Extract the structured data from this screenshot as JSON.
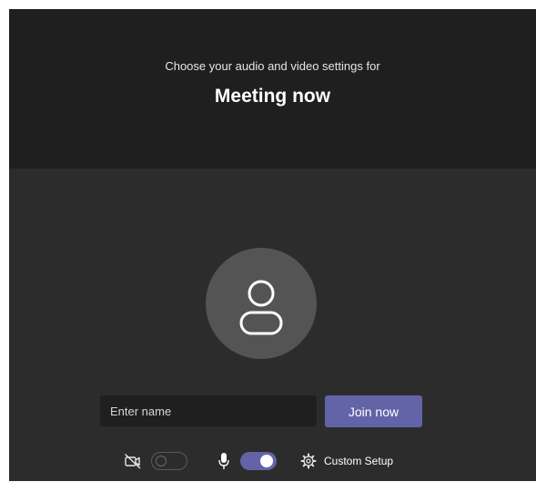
{
  "header": {
    "subtitle": "Choose your audio and video settings for",
    "meeting_title": "Meeting now"
  },
  "prejoin": {
    "avatar_icon": "person-icon",
    "name_input": {
      "value": "",
      "placeholder": "Enter name"
    },
    "join_label": "Join now"
  },
  "controls": {
    "camera": {
      "icon": "camera-off-icon",
      "enabled": false
    },
    "microphone": {
      "icon": "microphone-icon",
      "enabled": true
    },
    "custom_setup": {
      "icon": "gear-icon",
      "label": "Custom Setup"
    }
  },
  "colors": {
    "accent": "#6264a7",
    "header_bg": "#1f1f1f",
    "body_bg": "#2d2c2c",
    "avatar_bg": "#545454"
  }
}
